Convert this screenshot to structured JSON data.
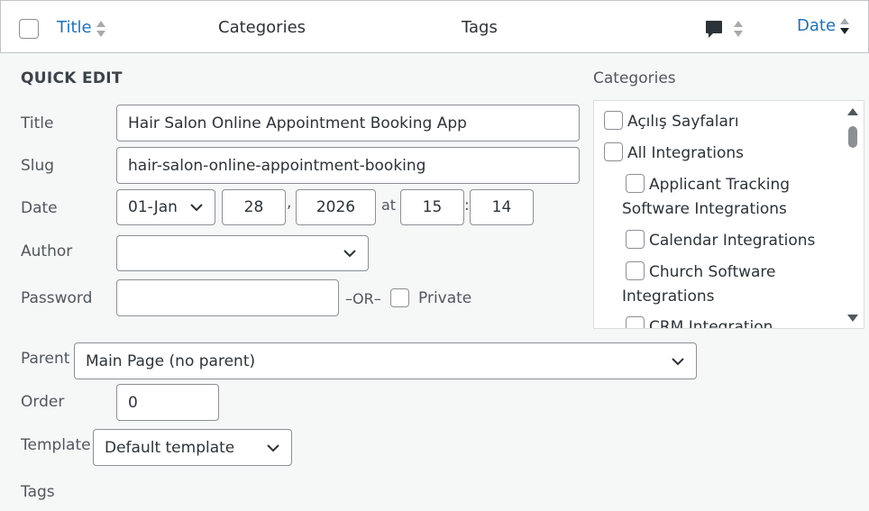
{
  "header": {
    "title": "Title",
    "categories": "Categories",
    "tags": "Tags",
    "date": "Date"
  },
  "quick_edit": {
    "heading": "QUICK EDIT",
    "title_label": "Title",
    "title_value": "Hair Salon Online Appointment Booking App",
    "slug_label": "Slug",
    "slug_value": "hair-salon-online-appointment-booking",
    "date_label": "Date",
    "date_month": "01-Jan",
    "date_day": "28",
    "date_comma": ",",
    "date_year": "2026",
    "date_at": "at",
    "date_hour": "15",
    "date_colon": ":",
    "date_minute": "14",
    "author_label": "Author",
    "author_value": "",
    "password_label": "Password",
    "password_value": "",
    "or_text": "–OR–",
    "private_label": "Private",
    "parent_label": "Parent",
    "parent_value": "Main Page (no parent)",
    "order_label": "Order",
    "order_value": "0",
    "template_label": "Template",
    "template_value": "Default template",
    "tags_label": "Tags"
  },
  "categories_panel": {
    "heading": "Categories",
    "items": [
      {
        "label": "Açılış Sayfaları"
      },
      {
        "label": "All Integrations"
      },
      {
        "label": "Applicant Tracking",
        "label2": "Software Integrations"
      },
      {
        "label": "Calendar Integrations"
      },
      {
        "label": "Church Software",
        "label2": "Integrations"
      },
      {
        "label": "CRM Integration"
      }
    ]
  },
  "colors": {
    "link": "#2271b1",
    "border": "#8c8f94",
    "background": "#f6f7f7"
  }
}
